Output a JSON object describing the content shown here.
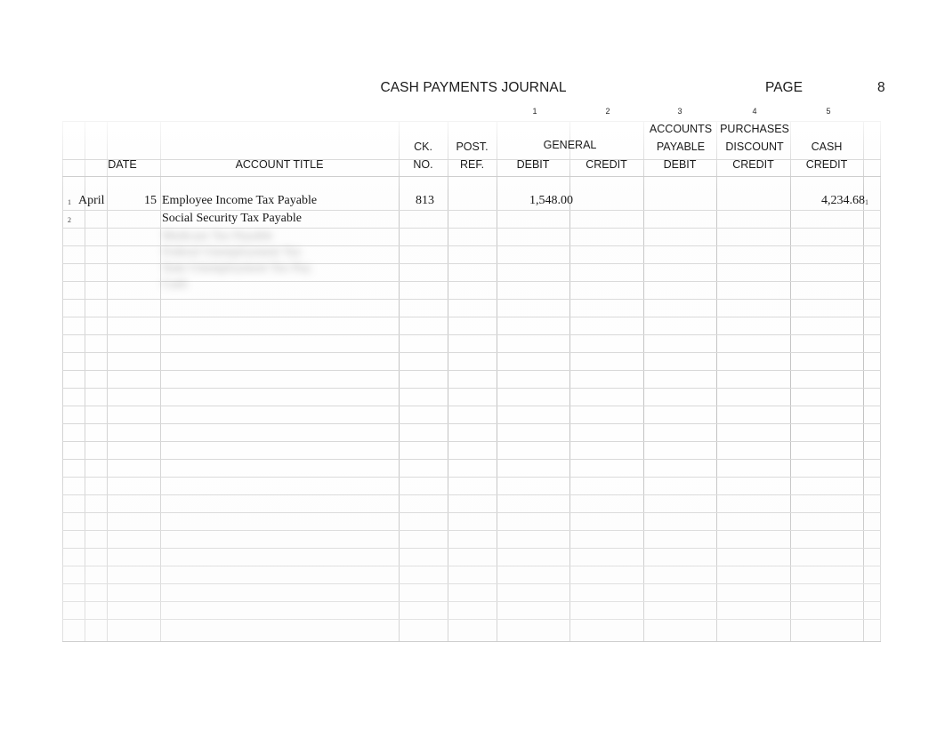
{
  "document": {
    "title": "CASH PAYMENTS JOURNAL",
    "page_label": "PAGE",
    "page_number": "8"
  },
  "table": {
    "column_numbers": [
      "1",
      "2",
      "3",
      "4",
      "5"
    ],
    "headers": {
      "date": "DATE",
      "account_title": "ACCOUNT TITLE",
      "ck_no_line1": "CK.",
      "ck_no_line2": "NO.",
      "post_ref_line1": "POST.",
      "post_ref_line2": "REF.",
      "general": "GENERAL",
      "general_debit": "DEBIT",
      "general_credit": "CREDIT",
      "accounts_payable_line1": "ACCOUNTS",
      "accounts_payable_line2": "PAYABLE",
      "accounts_payable_debit": "DEBIT",
      "purchases_discount_line1": "PURCHASES",
      "purchases_discount_line2": "DISCOUNT",
      "purchases_discount_credit": "CREDIT",
      "cash": "CASH",
      "cash_credit": "CREDIT"
    },
    "rows": [
      {
        "line_left": "1",
        "line_right": "1",
        "month": "April",
        "day": "15",
        "account_title": "Employee Income Tax Payable",
        "ck_no": "813",
        "post_ref": "",
        "general_debit": "1,548.00",
        "general_credit": "",
        "accounts_payable_debit": "",
        "purchases_discount_credit": "",
        "cash_credit": "4,234.68"
      },
      {
        "line_left": "2",
        "line_right": "",
        "month": "",
        "day": "",
        "account_title": "Social Security Tax Payable",
        "ck_no": "",
        "post_ref": "",
        "general_debit": "",
        "general_credit": "",
        "accounts_payable_debit": "",
        "purchases_discount_credit": "",
        "cash_credit": ""
      }
    ],
    "obscured_rows_note": "Remaining journal lines are blurred and illegible in the source image."
  }
}
